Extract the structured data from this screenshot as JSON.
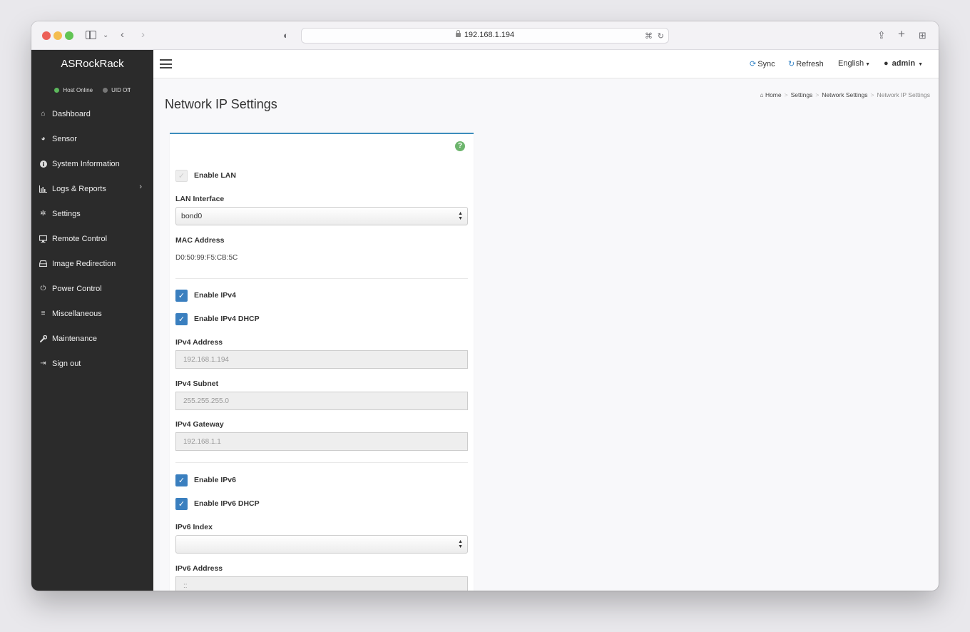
{
  "browser": {
    "url": "192.168.1.194"
  },
  "app": {
    "brand": "ASRockRack",
    "status": {
      "host": "Host Online",
      "uid": "UID Off"
    }
  },
  "nav": [
    {
      "label": "Dashboard",
      "icon": "home-icon"
    },
    {
      "label": "Sensor",
      "icon": "tachometer-icon"
    },
    {
      "label": "System Information",
      "icon": "info-icon"
    },
    {
      "label": "Logs & Reports",
      "icon": "bar-chart-icon"
    },
    {
      "label": "Settings",
      "icon": "gear-icon"
    },
    {
      "label": "Remote Control",
      "icon": "desktop-icon"
    },
    {
      "label": "Image Redirection",
      "icon": "hdd-icon"
    },
    {
      "label": "Power Control",
      "icon": "power-icon"
    },
    {
      "label": "Miscellaneous",
      "icon": "list-icon"
    },
    {
      "label": "Maintenance",
      "icon": "wrench-icon"
    },
    {
      "label": "Sign out",
      "icon": "sign-out-icon"
    }
  ],
  "header": {
    "sync": "Sync",
    "refresh": "Refresh",
    "language": "English",
    "user": "admin"
  },
  "page": {
    "title": "Network IP Settings",
    "breadcrumb": [
      "Home",
      "Settings",
      "Network Settings",
      "Network IP Settings"
    ]
  },
  "form": {
    "enable_lan": "Enable LAN",
    "lan_interface_label": "LAN Interface",
    "lan_interface_value": "bond0",
    "mac_label": "MAC Address",
    "mac_value": "D0:50:99:F5:CB:5C",
    "enable_ipv4": "Enable IPv4",
    "enable_ipv4_dhcp": "Enable IPv4 DHCP",
    "ipv4_address_label": "IPv4 Address",
    "ipv4_address_value": "192.168.1.194",
    "ipv4_subnet_label": "IPv4 Subnet",
    "ipv4_subnet_value": "255.255.255.0",
    "ipv4_gateway_label": "IPv4 Gateway",
    "ipv4_gateway_value": "192.168.1.1",
    "enable_ipv6": "Enable IPv6",
    "enable_ipv6_dhcp": "Enable IPv6 DHCP",
    "ipv6_index_label": "IPv6 Index",
    "ipv6_index_value": "",
    "ipv6_address_label": "IPv6 Address",
    "ipv6_address_value": "::"
  },
  "colors": {
    "accent": "#3c8dbc",
    "sidebar": "#2b2b2b",
    "checkbox": "#3a7fbf",
    "online": "#5cb85c",
    "help": "#6db56d"
  }
}
